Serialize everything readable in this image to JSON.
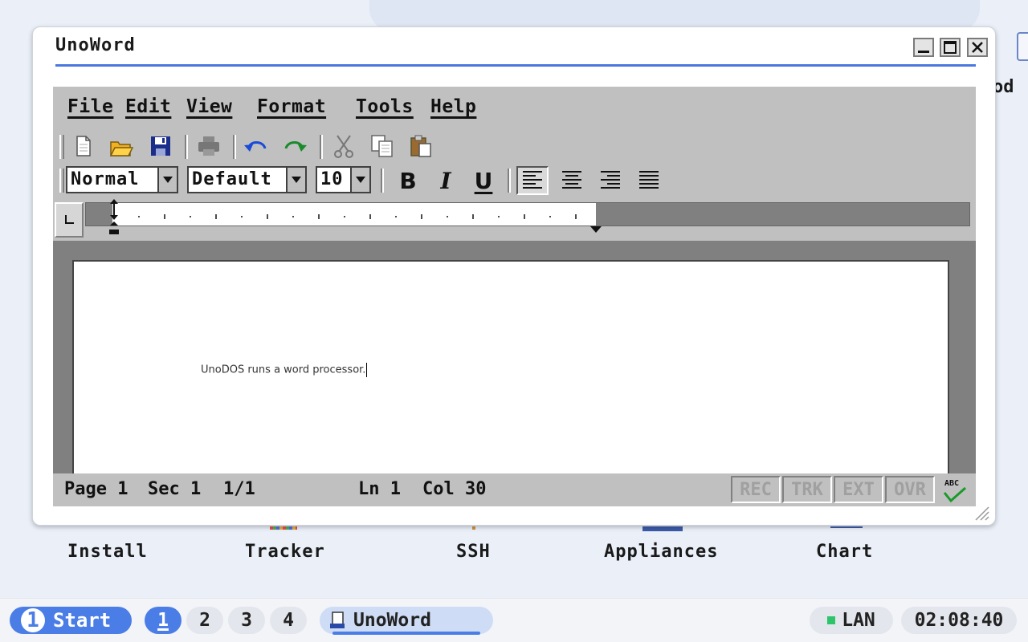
{
  "window": {
    "title": "UnoWord"
  },
  "menu": [
    "File",
    "Edit",
    "View",
    "Format",
    "Tools",
    "Help"
  ],
  "format_toolbar": {
    "style": "Normal",
    "font": "Default",
    "size": "10",
    "bold_label": "B",
    "italic_label": "I",
    "underline_label": "U"
  },
  "document": {
    "text": "UnoDOS runs a word processor."
  },
  "status": {
    "page": "Page 1",
    "section": "Sec 1",
    "pages": "1/1",
    "line": "Ln 1",
    "col": "Col 30",
    "modes": [
      "REC",
      "TRK",
      "EXT",
      "OVR"
    ]
  },
  "desktop": {
    "icons": [
      "Install",
      "Tracker",
      "SSH",
      "Appliances",
      "Chart"
    ],
    "partial_label": "od"
  },
  "taskbar": {
    "start_label": "Start",
    "start_badge": "1",
    "workspaces": [
      "1",
      "2",
      "3",
      "4"
    ],
    "active_workspace": "1",
    "task_label": "UnoWord",
    "network": "LAN",
    "clock": "02:08:40"
  },
  "colors": {
    "accent": "#4a7de6",
    "menu_bg": "#c0c0c0",
    "page_bg": "#ffffff",
    "network_ok": "#2dc46a"
  }
}
